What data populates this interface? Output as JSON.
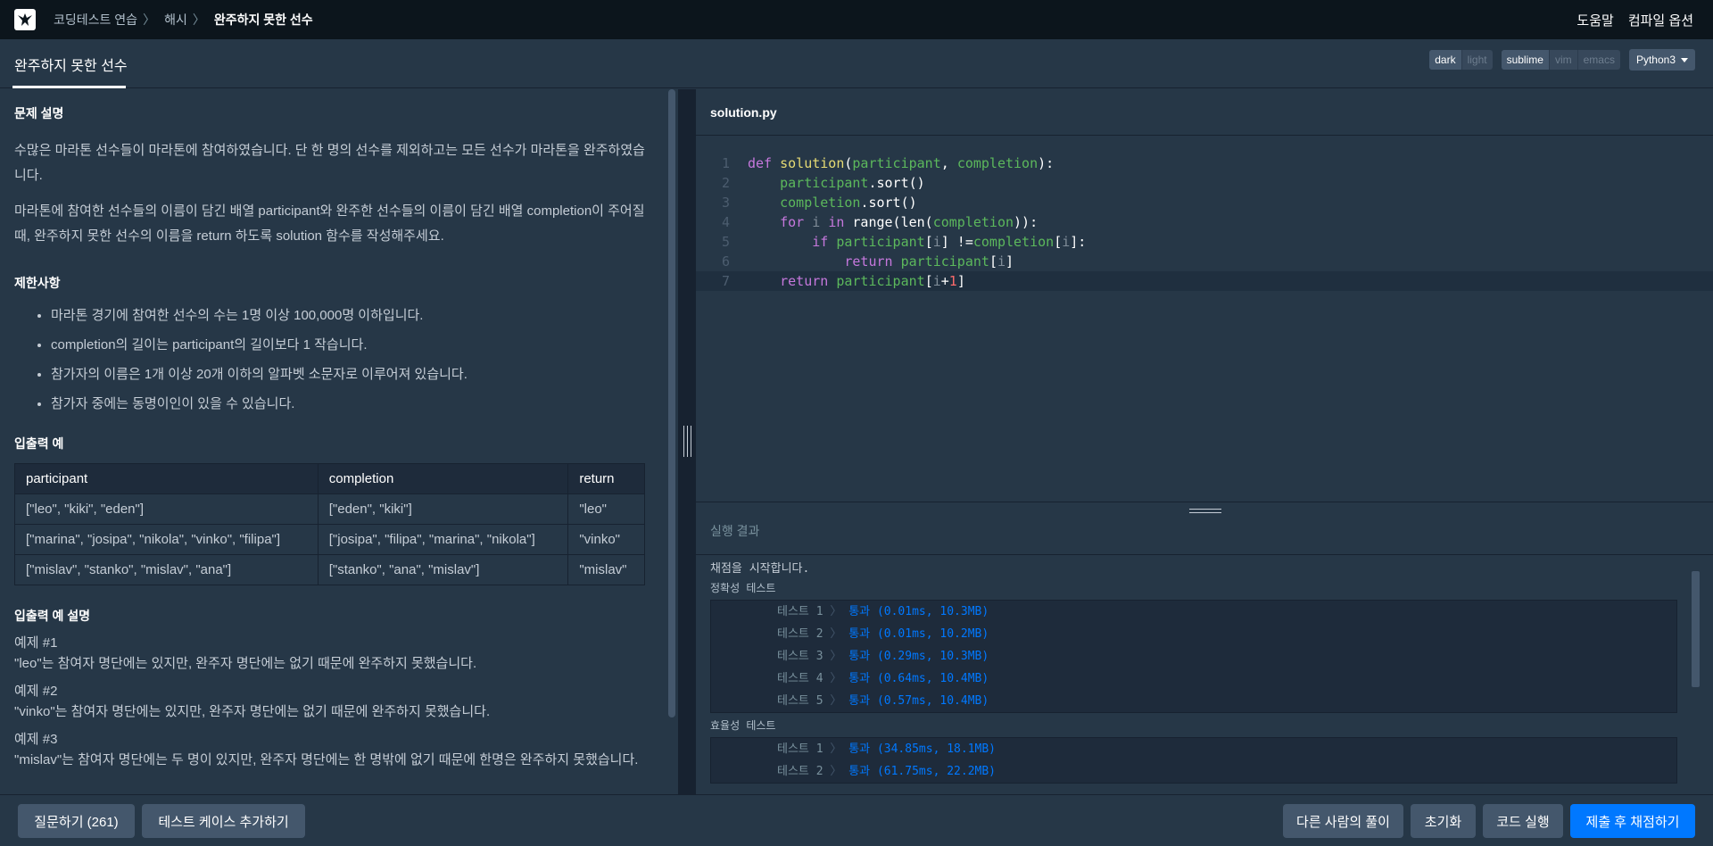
{
  "topnav": {
    "breadcrumbs": [
      "코딩테스트 연습",
      "해시",
      "완주하지 못한 선수"
    ],
    "help": "도움말",
    "compile_options": "컴파일 옵션"
  },
  "challenge": {
    "title": "완주하지 못한 선수"
  },
  "editor_options": {
    "theme": [
      "dark",
      "light"
    ],
    "keymap": [
      "sublime",
      "vim",
      "emacs"
    ],
    "language": "Python3"
  },
  "description": {
    "heading": "문제 설명",
    "paragraphs": [
      "수많은 마라톤 선수들이 마라톤에 참여하였습니다. 단 한 명의 선수를 제외하고는 모든 선수가 마라톤을 완주하였습니다.",
      "마라톤에 참여한 선수들의 이름이 담긴 배열 participant와 완주한 선수들의 이름이 담긴 배열 completion이 주어질 때, 완주하지 못한 선수의 이름을 return 하도록 solution 함수를 작성해주세요."
    ],
    "constraints_heading": "제한사항",
    "constraints": [
      "마라톤 경기에 참여한 선수의 수는 1명 이상 100,000명 이하입니다.",
      "completion의 길이는 participant의 길이보다 1 작습니다.",
      "참가자의 이름은 1개 이상 20개 이하의 알파벳 소문자로 이루어져 있습니다.",
      "참가자 중에는 동명이인이 있을 수 있습니다."
    ],
    "io_heading": "입출력 예",
    "io_table": {
      "headers": [
        "participant",
        "completion",
        "return"
      ],
      "rows": [
        [
          "[\"leo\", \"kiki\", \"eden\"]",
          "[\"eden\", \"kiki\"]",
          "\"leo\""
        ],
        [
          "[\"marina\", \"josipa\", \"nikola\", \"vinko\", \"filipa\"]",
          "[\"josipa\", \"filipa\", \"marina\", \"nikola\"]",
          "\"vinko\""
        ],
        [
          "[\"mislav\", \"stanko\", \"mislav\", \"ana\"]",
          "[\"stanko\", \"ana\", \"mislav\"]",
          "\"mislav\""
        ]
      ]
    },
    "io_explain_heading": "입출력 예 설명",
    "examples": [
      {
        "label": "예제 #1",
        "text": "\"leo\"는 참여자 명단에는 있지만, 완주자 명단에는 없기 때문에 완주하지 못했습니다."
      },
      {
        "label": "예제 #2",
        "text": "\"vinko\"는 참여자 명단에는 있지만, 완주자 명단에는 없기 때문에 완주하지 못했습니다."
      },
      {
        "label": "예제 #3",
        "text": "\"mislav\"는 참여자 명단에는 두 명이 있지만, 완주자 명단에는 한 명밖에 없기 때문에 한명은 완주하지 못했습니다."
      }
    ]
  },
  "editor": {
    "filename": "solution.py",
    "line_numbers": [
      "1",
      "2",
      "3",
      "4",
      "5",
      "6",
      "7"
    ]
  },
  "results": {
    "heading": "실행 결과",
    "start": "채점을 시작합니다.",
    "accuracy_label": "정확성  테스트",
    "efficiency_label": "효율성  테스트",
    "accuracy": [
      {
        "name": "테스트 1",
        "result": "통과 (0.01ms, 10.3MB)"
      },
      {
        "name": "테스트 2",
        "result": "통과 (0.01ms, 10.2MB)"
      },
      {
        "name": "테스트 3",
        "result": "통과 (0.29ms, 10.3MB)"
      },
      {
        "name": "테스트 4",
        "result": "통과 (0.64ms, 10.4MB)"
      },
      {
        "name": "테스트 5",
        "result": "통과 (0.57ms, 10.4MB)"
      }
    ],
    "efficiency": [
      {
        "name": "테스트 1",
        "result": "통과 (34.85ms, 18.1MB)"
      },
      {
        "name": "테스트 2",
        "result": "통과 (61.75ms, 22.2MB)"
      }
    ]
  },
  "bottom": {
    "question": "질문하기 (261)",
    "add_testcase": "테스트 케이스 추가하기",
    "others_solutions": "다른 사람의 풀이",
    "reset": "초기화",
    "run": "코드 실행",
    "submit": "제출 후 채점하기"
  }
}
